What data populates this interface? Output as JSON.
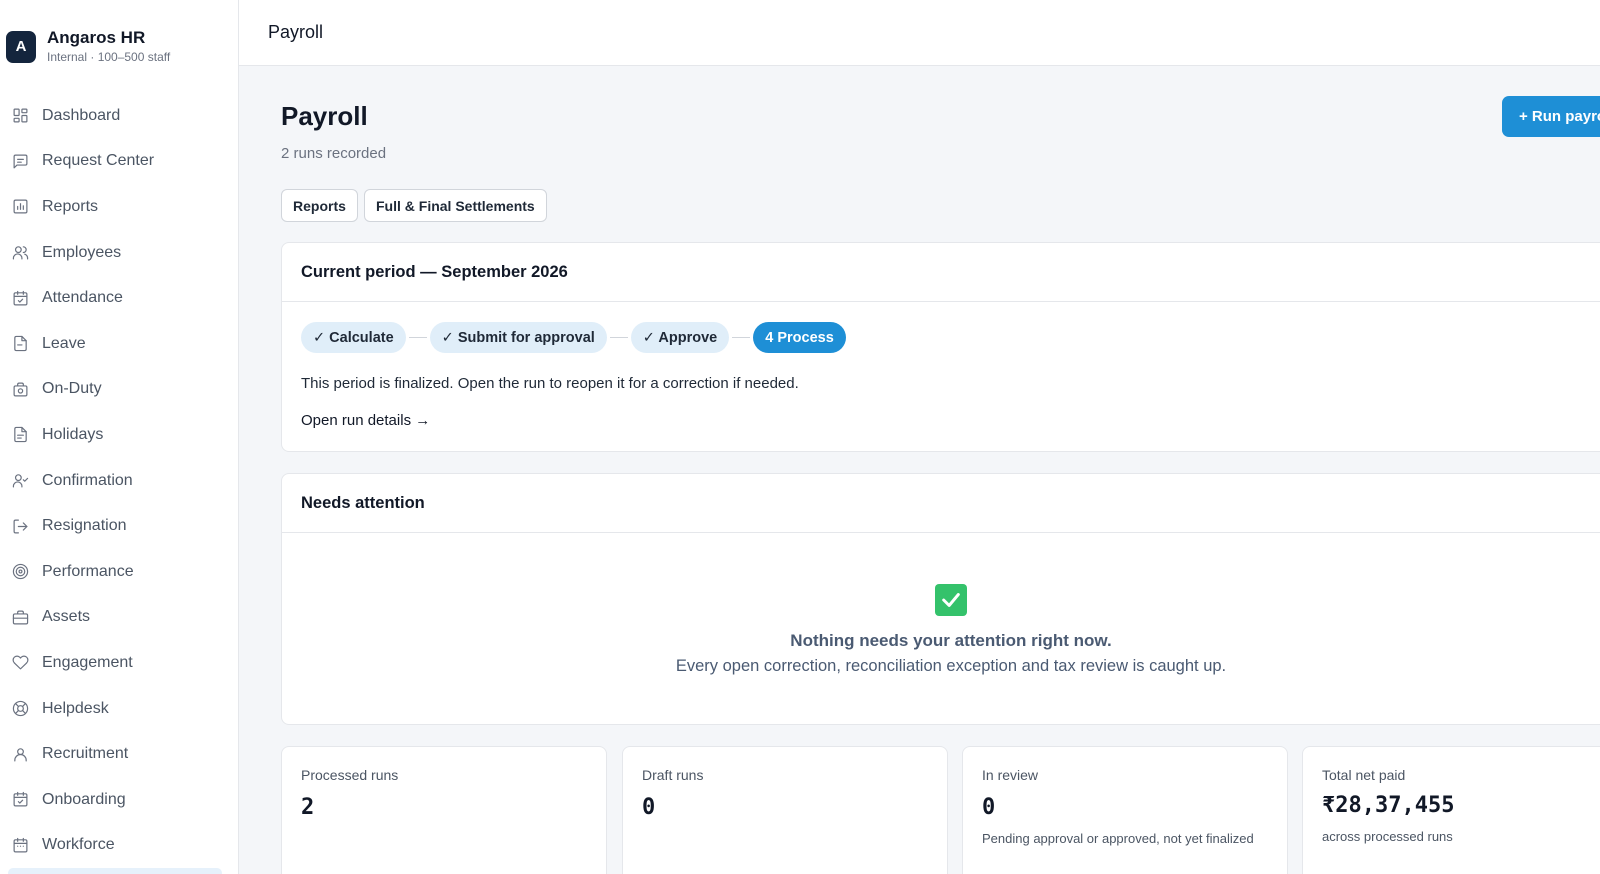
{
  "brand": {
    "logo_letter": "A",
    "name": "Angaros HR",
    "subtitle": "Internal · 100–500 staff"
  },
  "sidebar": {
    "items": [
      {
        "label": "Dashboard",
        "icon": "grid-icon"
      },
      {
        "label": "Request Center",
        "icon": "message-square-icon"
      },
      {
        "label": "Reports",
        "icon": "bar-chart-icon"
      },
      {
        "label": "Employees",
        "icon": "users-icon"
      },
      {
        "label": "Attendance",
        "icon": "calendar-check-icon"
      },
      {
        "label": "Leave",
        "icon": "file-icon"
      },
      {
        "label": "On-Duty",
        "icon": "briefcase-clock-icon"
      },
      {
        "label": "Holidays",
        "icon": "file-text-icon"
      },
      {
        "label": "Confirmation",
        "icon": "user-check-icon"
      },
      {
        "label": "Resignation",
        "icon": "log-out-icon"
      },
      {
        "label": "Performance",
        "icon": "target-icon"
      },
      {
        "label": "Assets",
        "icon": "briefcase-icon"
      },
      {
        "label": "Engagement",
        "icon": "heart-icon"
      },
      {
        "label": "Helpdesk",
        "icon": "life-buoy-icon"
      },
      {
        "label": "Recruitment",
        "icon": "user-icon"
      },
      {
        "label": "Onboarding",
        "icon": "calendar-check-icon"
      },
      {
        "label": "Workforce",
        "icon": "calendar-icon"
      }
    ]
  },
  "topbar": {
    "title": "Payroll"
  },
  "page": {
    "title": "Payroll",
    "subtitle": "2 runs recorded",
    "run_button": "+ Run payroll",
    "tabs": [
      "Reports",
      "Full & Final Settlements"
    ]
  },
  "current_period": {
    "title": "Current period — September 2026",
    "steps": [
      {
        "label": "✓ Calculate",
        "state": "done"
      },
      {
        "label": "✓ Submit for approval",
        "state": "done"
      },
      {
        "label": "✓ Approve",
        "state": "done"
      },
      {
        "label": "4 Process",
        "state": "active"
      }
    ],
    "note": "This period is finalized. Open the run to reopen it for a correction if needed.",
    "link": "Open run details →"
  },
  "needs_attention": {
    "title": "Needs attention",
    "empty_icon": "check-square-icon",
    "empty_title": "Nothing needs your attention right now.",
    "empty_subtitle": "Every open correction, reconciliation exception and tax review is caught up."
  },
  "stats": [
    {
      "label": "Processed runs",
      "value": "2",
      "note": ""
    },
    {
      "label": "Draft runs",
      "value": "0",
      "note": ""
    },
    {
      "label": "In review",
      "value": "0",
      "note": "Pending approval or approved, not yet finalized"
    },
    {
      "label": "Total net paid",
      "value": "₹28,37,455",
      "note": "across processed runs"
    }
  ],
  "colors": {
    "accent": "#1e8fd6",
    "brand_dark": "#14253d",
    "success": "#34c26b",
    "step_bg": "#e0eef9"
  }
}
